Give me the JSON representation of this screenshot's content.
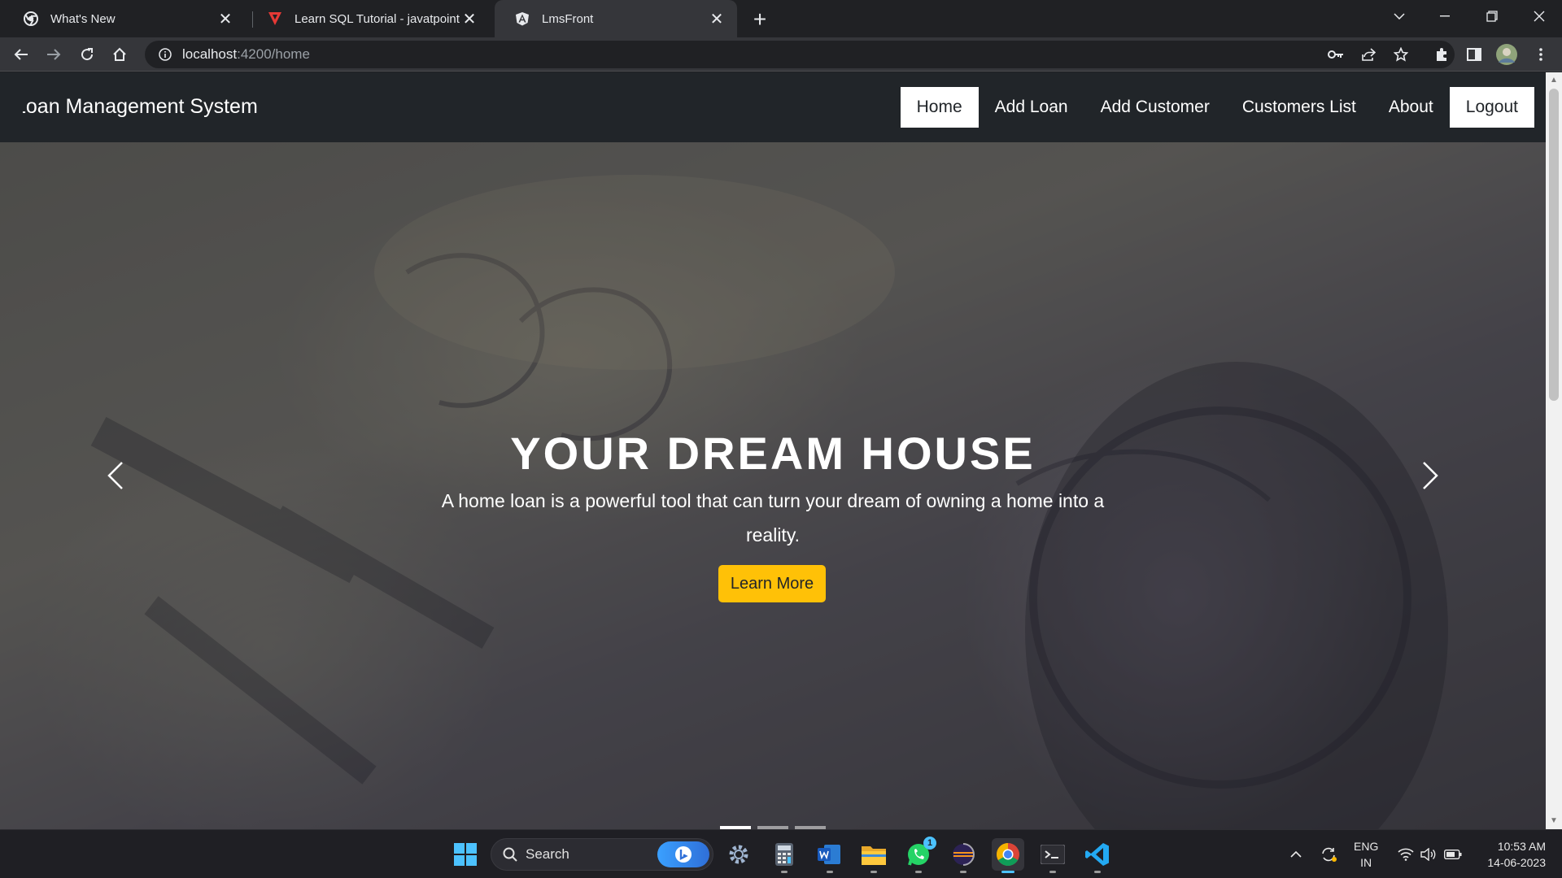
{
  "browser": {
    "tabs": [
      {
        "title": "What's New",
        "icon": "chrome-icon",
        "active": false
      },
      {
        "title": "Learn SQL Tutorial - javatpoint",
        "icon": "javatpoint-icon",
        "active": false
      },
      {
        "title": "LmsFront",
        "icon": "angular-icon",
        "active": true
      }
    ],
    "close_glyph": "✕",
    "new_tab_glyph": "+",
    "url": {
      "host": "localhost",
      "path": ":4200/home"
    }
  },
  "site": {
    "brand": "Loan Management System",
    "nav": {
      "home": "Home",
      "add_loan": "Add Loan",
      "add_customer": "Add Customer",
      "customers_list": "Customers List",
      "about": "About",
      "logout": "Logout"
    },
    "hero": {
      "title": "YOUR DREAM HOUSE",
      "text": "A home loan is a powerful tool that can turn your dream of owning a home into a reality.",
      "button": "Learn More",
      "slides": 3,
      "active_slide": 1
    }
  },
  "taskbar": {
    "search_placeholder": "Search",
    "whatsapp_badge": "1",
    "language": {
      "line1": "ENG",
      "line2": "IN"
    },
    "time": "10:53 AM",
    "date": "14-06-2023"
  },
  "colors": {
    "navbar": "#212529",
    "accent_button": "#ffc107",
    "taskbar_active": "#4cc2ff"
  }
}
